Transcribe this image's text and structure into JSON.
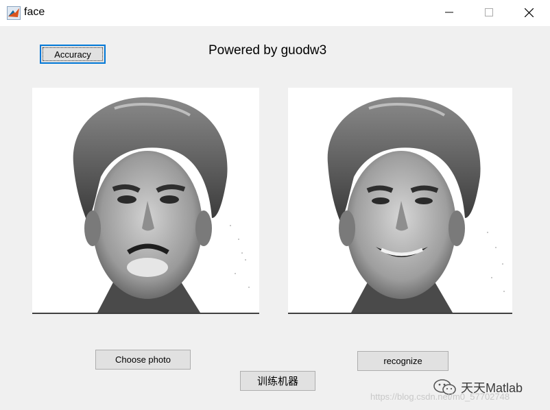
{
  "window": {
    "title": "face",
    "icon": "matlab-icon",
    "controls": {
      "minimize": "minimize-icon",
      "maximize": "maximize-icon",
      "close": "close-icon"
    }
  },
  "buttons": {
    "accuracy": "Accuracy",
    "choose_photo": "Choose photo",
    "recognize": "recognize",
    "train": "训练机器"
  },
  "header": {
    "powered_by": "Powered by guodw3"
  },
  "images": {
    "left": {
      "icon": "sad-face-photo",
      "expression": "sad"
    },
    "right": {
      "icon": "happy-face-photo",
      "expression": "happy"
    }
  },
  "watermark": {
    "brand": "天天Matlab",
    "url": "https://blog.csdn.net/m0_57702748",
    "icon": "wechat-icon"
  }
}
